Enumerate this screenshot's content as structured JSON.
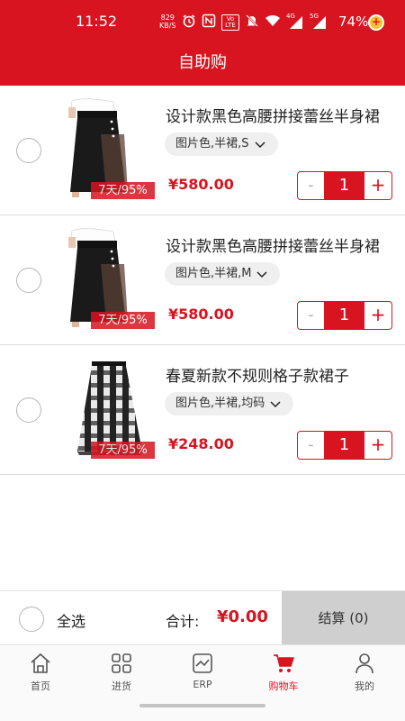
{
  "status_bar": {
    "time": "11:52",
    "net_speed_value": "829",
    "net_speed_unit": "KB/S",
    "icons": [
      "alarm-icon",
      "nfc-icon",
      "volte-icon",
      "mute-icon",
      "wifi-icon",
      "4g-signal-icon",
      "5g-signal-icon"
    ],
    "volte_label": "Vo LTE",
    "signal_4g": "4G",
    "signal_5g": "5G",
    "battery": "74%"
  },
  "header": {
    "title": "自助购"
  },
  "cart": {
    "items": [
      {
        "title": "设计款黑色高腰拼接蕾丝半身裙",
        "spec": "图片色,半裙,S",
        "tag": "7天/95%",
        "price": "¥580.00",
        "qty": "1",
        "minus": "-",
        "plus": "+",
        "image": "black-lace-skirt"
      },
      {
        "title": "设计款黑色高腰拼接蕾丝半身裙",
        "spec": "图片色,半裙,M",
        "tag": "7天/95%",
        "price": "¥580.00",
        "qty": "1",
        "minus": "-",
        "plus": "+",
        "image": "black-lace-skirt"
      },
      {
        "title": "春夏新款不规则格子款裙子",
        "spec": "图片色,半裙,均码",
        "tag": "7天/95%",
        "price": "¥248.00",
        "qty": "1",
        "minus": "-",
        "plus": "+",
        "image": "plaid-tulle-skirt"
      }
    ]
  },
  "footer": {
    "select_all": "全选",
    "total_label": "合计:",
    "total_value": "¥0.00",
    "checkout_button": "结算 (0)"
  },
  "tabbar": {
    "tabs": [
      {
        "label": "首页",
        "icon": "home-icon",
        "active": false
      },
      {
        "label": "进货",
        "icon": "grid-icon",
        "active": false
      },
      {
        "label": "ERP",
        "icon": "chart-icon",
        "active": false
      },
      {
        "label": "购物车",
        "icon": "cart-icon",
        "active": true
      },
      {
        "label": "我的",
        "icon": "user-icon",
        "active": false
      }
    ]
  },
  "colors": {
    "brand": "#d7141f",
    "checkout_disabled": "#cfcfcf"
  }
}
